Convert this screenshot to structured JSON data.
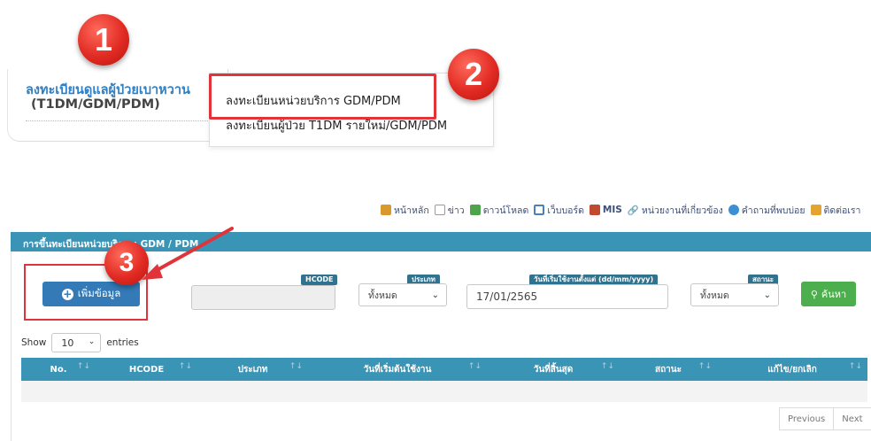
{
  "menu": {
    "title": "ลงทะเบียนดูแลผู้ป่วยเบาหวาน",
    "subtitle": "(T1DM/GDM/PDM)",
    "submenu": [
      "ลงทะเบียนหน่วยบริการ GDM/PDM",
      "ลงทะเบียนผู้ป่วย T1DM รายใหม่/GDM/PDM"
    ]
  },
  "annotations": {
    "step1": "1",
    "step2": "2",
    "step3": "3"
  },
  "toplinks": [
    {
      "label": "หน้าหลัก",
      "icon": "home-icon",
      "color": "#d99a2b"
    },
    {
      "label": "ข่าว",
      "icon": "document-icon",
      "color": "#9a9a9a"
    },
    {
      "label": "ดาวน์โหลด",
      "icon": "download-icon",
      "color": "#4ea44b"
    },
    {
      "label": "เว็บบอร์ด",
      "icon": "calendar-icon",
      "color": "#4a7fc1"
    },
    {
      "label": "MIS",
      "icon": "chart-icon",
      "color": "#c1492f"
    },
    {
      "label": "หน่วยงานที่เกี่ยวข้อง",
      "icon": "link-icon",
      "color": "#777777"
    },
    {
      "label": "คำถามที่พบบ่อย",
      "icon": "help-icon",
      "color": "#3b8fd4"
    },
    {
      "label": "ติดต่อเรา",
      "icon": "mail-icon",
      "color": "#e3a431"
    }
  ],
  "panel": {
    "title": "การขึ้นทะเบียนหน่วยบริการ: GDM / PDM",
    "add_button": "เพิ่มข้อมูล",
    "hcode_label": "HCODE",
    "hcode_value": "",
    "type_label": "ประเภท",
    "type_value": "ทั้งหมด",
    "start_label": "วันที่เริ่มใช้งานตั้งแต่ (dd/mm/yyyy)",
    "start_value": "17/01/2565",
    "status_label": "สถานะ",
    "status_value": "ทั้งหมด",
    "search_button": "ค้นหา"
  },
  "table": {
    "show": "Show",
    "entries_value": "10",
    "entries": "entries",
    "columns": [
      "No.",
      "HCODE",
      "ประเภท",
      "วันที่เริ่มต้นใช้งาน",
      "วันที่สิ้นสุด",
      "สถานะ",
      "แก้ไข/ยกเลิก"
    ]
  },
  "pager": {
    "previous": "Previous",
    "next": "Next"
  },
  "colors": {
    "accent": "#3a94b6",
    "annotation": "#e0343a",
    "primary_button": "#337ab7",
    "success_button": "#4cae4c"
  }
}
